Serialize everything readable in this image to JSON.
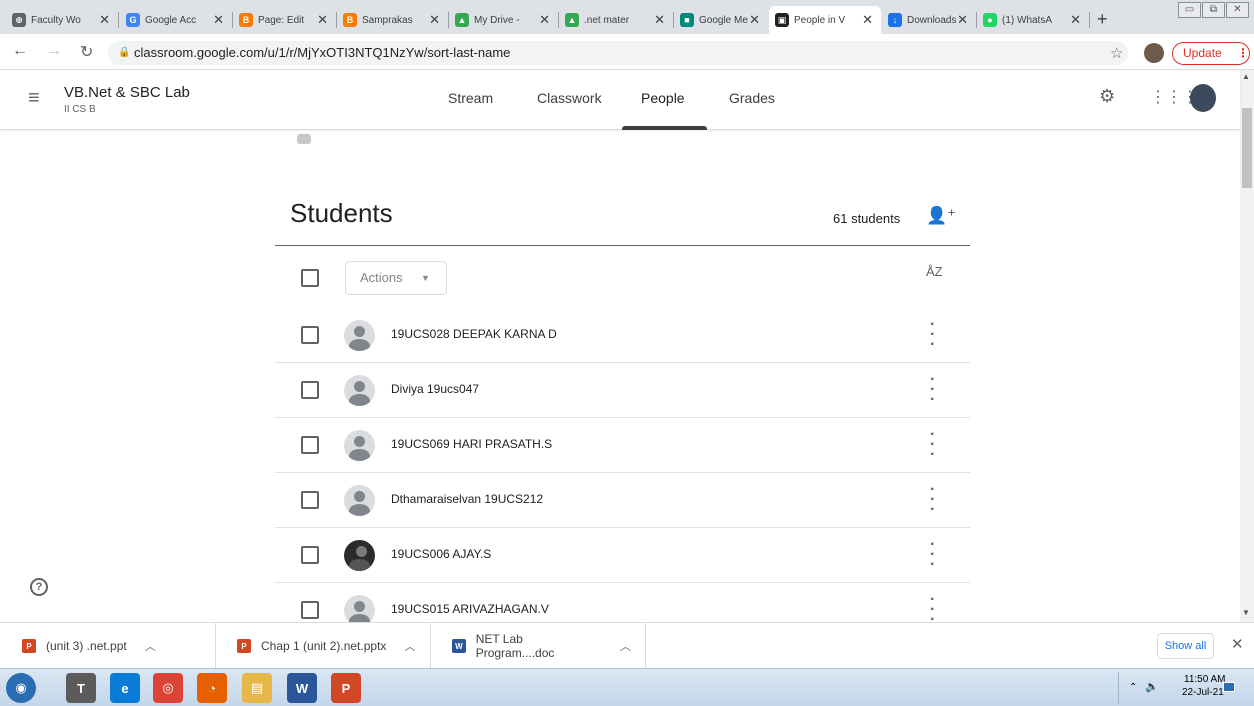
{
  "browser": {
    "tabs": [
      {
        "title": "Faculty Wo",
        "fav_color": "#5f6368",
        "fav_char": "⊕"
      },
      {
        "title": "Google Acc",
        "fav_color": "#4285f4",
        "fav_char": "G"
      },
      {
        "title": "Page: Edit",
        "fav_color": "#f57c00",
        "fav_char": "B"
      },
      {
        "title": "Samprakas",
        "fav_color": "#f57c00",
        "fav_char": "B"
      },
      {
        "title": "My Drive -",
        "fav_color": "#34a853",
        "fav_char": "▲"
      },
      {
        "title": ".net mater",
        "fav_color": "#34a853",
        "fav_char": "▲"
      },
      {
        "title": "Google Me",
        "fav_color": "#00897b",
        "fav_char": "■"
      },
      {
        "title": "People in V",
        "fav_color": "#202124",
        "fav_char": "▣"
      },
      {
        "title": "Downloads",
        "fav_color": "#1a73e8",
        "fav_char": "↓"
      },
      {
        "title": "(1) WhatsA",
        "fav_color": "#25d366",
        "fav_char": "●"
      }
    ],
    "url": "classroom.google.com/u/1/r/MjYxOTI3NTQ1NzYw/sort-last-name",
    "update_label": "Update"
  },
  "classroom": {
    "class_name": "VB.Net & SBC Lab",
    "section": "II CS B",
    "nav": [
      "Stream",
      "Classwork",
      "People",
      "Grades"
    ],
    "active_nav": "People"
  },
  "students": {
    "title": "Students",
    "count": "61 students",
    "actions_label": "Actions",
    "list": [
      {
        "name": "19UCS028 DEEPAK KARNA D",
        "photo": false
      },
      {
        "name": "Diviya 19ucs047",
        "photo": false
      },
      {
        "name": "19UCS069 HARI PRASATH.S",
        "photo": false
      },
      {
        "name": "Dthamaraiselvan 19UCS212",
        "photo": false
      },
      {
        "name": "19UCS006 AJAY.S",
        "photo": true
      },
      {
        "name": "19UCS015 ARIVAZHAGAN.V",
        "photo": false
      }
    ]
  },
  "downloads": {
    "items": [
      {
        "name": "(unit 3) .net.ppt",
        "icon_color": "#d24726",
        "icon_char": "P"
      },
      {
        "name": "Chap 1 (unit 2).net.pptx",
        "icon_color": "#d24726",
        "icon_char": "P"
      },
      {
        "name": "NET Lab Program....doc",
        "icon_color": "#2b579a",
        "icon_char": "W"
      }
    ],
    "show_all_label": "Show all"
  },
  "taskbar": {
    "time": "11:50 AM",
    "date": "22-Jul-21",
    "apps": [
      {
        "name": "start-orb",
        "color": "#2a6db3",
        "char": "◉"
      },
      {
        "name": "tally-erp",
        "color": "#5b5b5b",
        "char": "T"
      },
      {
        "name": "edge",
        "color": "#0a7bd6",
        "char": "e"
      },
      {
        "name": "chrome",
        "color": "#db4437",
        "char": "◎"
      },
      {
        "name": "firefox",
        "color": "#e66000",
        "char": "◔"
      },
      {
        "name": "explorer",
        "color": "#e6b84a",
        "char": "▤"
      },
      {
        "name": "word",
        "color": "#2b579a",
        "char": "W"
      },
      {
        "name": "powerpoint",
        "color": "#d24726",
        "char": "P"
      }
    ]
  }
}
